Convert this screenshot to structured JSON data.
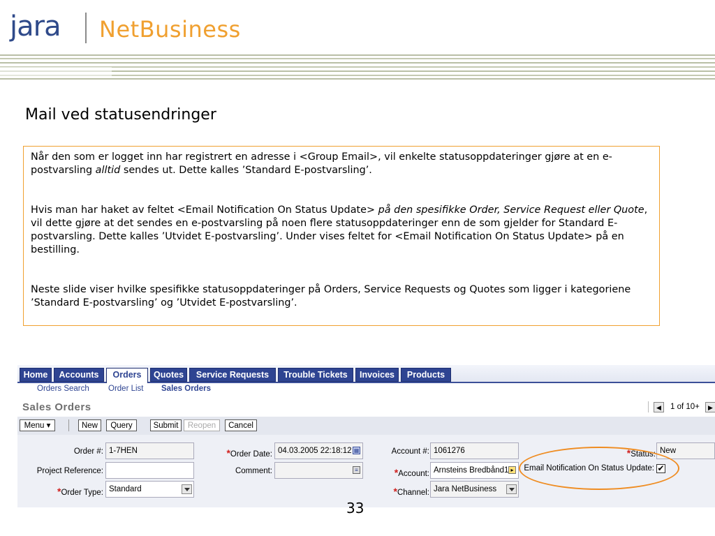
{
  "logo": {
    "brand": "jara",
    "product": "NetBusiness"
  },
  "slide": {
    "title": "Mail ved statusendringer",
    "para1_a": "Når den som er logget inn har registrert en adresse i <Group Email>, vil enkelte statusoppdateringer gjøre at en e-postvarsling ",
    "para1_em": "alltid",
    "para1_b": " sendes ut. Dette kalles ’Standard E-postvarsling’.",
    "para2_a": "Hvis man har haket av feltet <Email Notification On Status Update> ",
    "para2_em": "på den spesifikke Order, Service Request eller Quote",
    "para2_b": ", vil dette gjøre at det sendes en e-postvarsling på noen flere statusoppdateringer enn de som gjelder for Standard E-postvarsling. Dette kalles ’Utvidet E-postvarsling’. Under vises feltet for <Email Notification On Status Update> på en bestilling.",
    "para3": "Neste slide viser hvilke spesifikke statusoppdateringer på Orders, Service Requests og Quotes som ligger i kategoriene ’Standard E-postvarsling’ og ’Utvidet E-postvarsling’.",
    "page_number": "33"
  },
  "app": {
    "tabs": [
      "Home",
      "Accounts",
      "Orders",
      "Quotes",
      "Service Requests",
      "Trouble Tickets",
      "Invoices",
      "Products"
    ],
    "active_tab": "Orders",
    "subnav": [
      "Orders Search",
      "Order List",
      "Sales Orders"
    ],
    "view_title": "Sales Orders",
    "pager": "1 of 10+",
    "toolbar": {
      "menu": "Menu ▾",
      "new": "New",
      "query": "Query",
      "submit": "Submit",
      "reopen": "Reopen",
      "cancel": "Cancel"
    },
    "form": {
      "order_no_label": "Order #:",
      "order_no": "1-7HEN",
      "project_ref_label": "Project Reference:",
      "project_ref": "",
      "order_type_label": "Order Type:",
      "order_type": "Standard",
      "order_date_label": "Order Date:",
      "order_date": "04.03.2005 22:18:12",
      "comment_label": "Comment:",
      "comment": "",
      "account_no_label": "Account #:",
      "account_no": "1061276",
      "account_label": "Account:",
      "account": "Arnsteins Bredbånd1",
      "channel_label": "Channel:",
      "channel": "Jara NetBusiness",
      "status_label": "Status:",
      "status": "New",
      "email_notif_label": "Email Notification On Status Update:",
      "email_notif_checked": true
    }
  },
  "colors": {
    "accent_orange": "#f0a030",
    "nav_blue": "#2e4492",
    "required_red": "#d0201e"
  }
}
